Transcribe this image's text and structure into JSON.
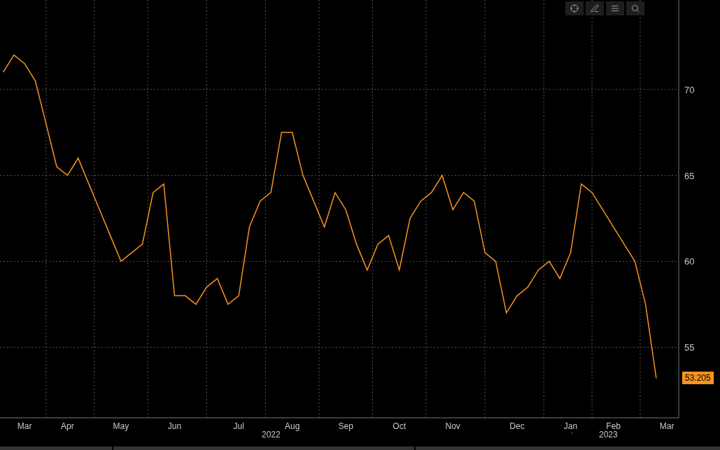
{
  "toolbar": {
    "buttons": [
      {
        "kind": "crosshair"
      },
      {
        "kind": "draw"
      },
      {
        "kind": "list"
      },
      {
        "kind": "search"
      }
    ]
  },
  "chart": {
    "chart_data": {
      "type": "line",
      "series": [
        {
          "color": "#f7931e",
          "values": [
            71,
            72,
            71.5,
            70.5,
            68,
            65.5,
            65,
            66,
            64.5,
            63,
            61.5,
            60,
            60.5,
            61,
            64,
            64.5,
            58,
            58,
            57.5,
            58.5,
            59,
            57.5,
            58,
            62,
            63.5,
            64,
            67.5,
            67.5,
            65,
            63.5,
            62,
            64,
            63,
            61,
            59.5,
            61,
            61.5,
            59.5,
            62.5,
            63.5,
            64,
            65,
            63,
            64,
            63.5,
            60.5,
            60,
            57,
            58,
            58.5,
            59.5,
            60,
            59,
            60.5,
            64.5,
            64,
            63,
            62,
            61,
            60,
            57.5,
            53.2,
            null
          ]
        }
      ],
      "categories": [
        null,
        null,
        "Mar",
        null,
        null,
        null,
        "Apr",
        null,
        null,
        null,
        null,
        "May",
        null,
        null,
        null,
        null,
        "Jun",
        null,
        null,
        null,
        null,
        null,
        "Jul",
        null,
        null,
        null,
        null,
        "Aug",
        null,
        null,
        null,
        null,
        "Sep",
        null,
        null,
        null,
        null,
        "Oct",
        null,
        null,
        null,
        null,
        "Nov",
        null,
        null,
        null,
        null,
        null,
        "Dec",
        null,
        null,
        null,
        null,
        "Jan",
        null,
        null,
        null,
        "Feb",
        null,
        null,
        null,
        null,
        "Mar"
      ],
      "grid": true,
      "ylim": [
        50.9,
        75.2
      ],
      "yticks": [
        55,
        60,
        65,
        70
      ]
    },
    "year_labels": [
      "2022",
      "2023"
    ],
    "last_price_label": "53.205"
  }
}
